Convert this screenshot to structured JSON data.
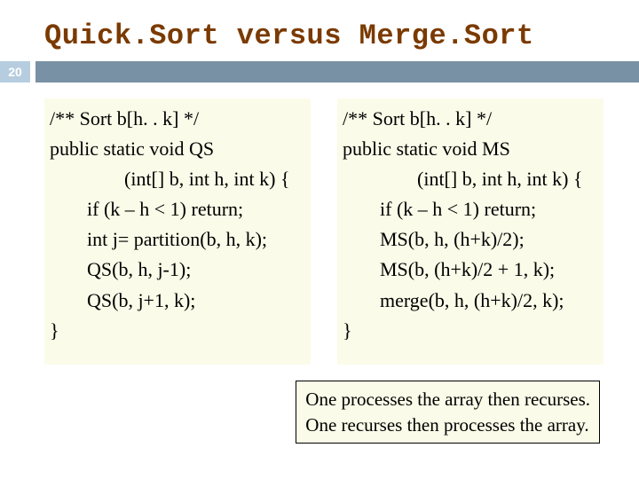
{
  "title": "Quick.Sort versus Merge.Sort",
  "page_number": "20",
  "left": {
    "l1": "/** Sort b[h. . k] */",
    "l2": "public static void QS",
    "l3": "(int[] b, int h, int k) {",
    "l4": "if (k – h < 1) return;",
    "l5": "int j=  partition(b, h, k);",
    "l6": "QS(b, h, j-1);",
    "l7": "QS(b, j+1, k);",
    "l8": "}"
  },
  "right": {
    "l1": "/** Sort b[h. . k] */",
    "l2": "public static void MS",
    "l3": "(int[] b, int h, int k) {",
    "l4": "if (k  – h < 1) return;",
    "l5": "MS(b, h, (h+k)/2);",
    "l6": "MS(b, (h+k)/2 + 1, k);",
    "l7": "merge(b, h, (h+k)/2, k);",
    "l8": "}"
  },
  "note": {
    "line1": "One processes the array then recurses.",
    "line2": "One recurses then processes the array."
  }
}
